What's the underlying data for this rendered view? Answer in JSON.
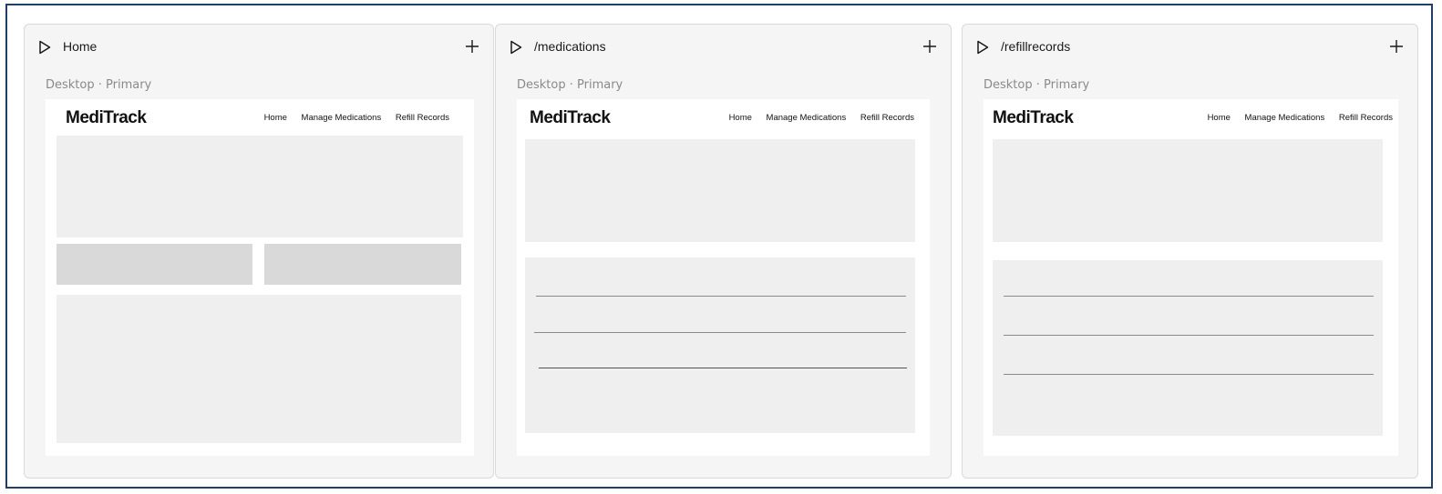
{
  "panels": [
    {
      "title": "Home",
      "device_label": "Desktop · Primary",
      "site": {
        "logo": "MediTrack",
        "nav": [
          "Home",
          "Manage Medications",
          "Refill Records"
        ]
      }
    },
    {
      "title": "/medications",
      "device_label": "Desktop · Primary",
      "site": {
        "logo": "MediTrack",
        "nav": [
          "Home",
          "Manage Medications",
          "Refill Records"
        ]
      }
    },
    {
      "title": "/refillrecords",
      "device_label": "Desktop · Primary",
      "site": {
        "logo": "MediTrack",
        "nav": [
          "Home",
          "Manage Medications",
          "Refill Records"
        ]
      }
    }
  ],
  "icons": {
    "run": "play-icon",
    "add": "plus-icon"
  },
  "colors": {
    "frame_border": "#1f3f66",
    "panel_bg": "#f5f5f5",
    "placeholder": "#efefef",
    "placeholder_dark": "#d9d9d9"
  }
}
